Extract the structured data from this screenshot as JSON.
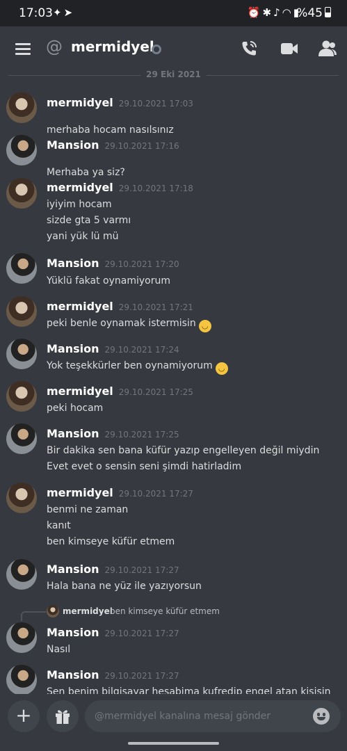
{
  "status_bar": {
    "time": "17:03",
    "battery": "%45"
  },
  "header": {
    "channel_name": "mermidyel"
  },
  "date_separator": "29 Eki 2021",
  "messages": [
    {
      "author": "mermidyel",
      "timestamp": "29.10.2021 17:03",
      "lines": [
        "merhaba hocam nasılsınız"
      ]
    },
    {
      "author": "Mansion",
      "timestamp": "29.10.2021 17:16",
      "lines": [
        "Merhaba ya siz?"
      ]
    },
    {
      "author": "mermidyel",
      "timestamp": "29.10.2021 17:18",
      "lines": [
        "iyiyim hocam",
        "sizde gta 5 varmı",
        "yani yük lü mü"
      ]
    },
    {
      "author": "Mansion",
      "timestamp": "29.10.2021 17:20",
      "lines": [
        "Yüklü fakat oynamiyorum"
      ]
    },
    {
      "author": "mermidyel",
      "timestamp": "29.10.2021 17:21",
      "lines": [
        "peki benle oynamak istermisin"
      ]
    },
    {
      "author": "Mansion",
      "timestamp": "29.10.2021 17:24",
      "lines": [
        "Yok teşekkürler ben oynamiyorum"
      ]
    },
    {
      "author": "mermidyel",
      "timestamp": "29.10.2021 17:25",
      "lines": [
        "peki hocam"
      ]
    },
    {
      "author": "Mansion",
      "timestamp": "29.10.2021 17:25",
      "lines": [
        "Bir dakika sen bana küfür yazıp engelleyen değil miydin",
        "Evet evet o sensin seni şimdi hatirladim"
      ]
    },
    {
      "author": "mermidyel",
      "timestamp": "29.10.2021 17:27",
      "lines": [
        "benmi ne zaman",
        "kanıt",
        "ben kimseye küfür etmem"
      ]
    },
    {
      "author": "Mansion",
      "timestamp": "29.10.2021 17:27",
      "lines": [
        "Hala bana ne yüz ile yazıyorsun"
      ]
    },
    {
      "author": "Mansion",
      "timestamp": "29.10.2021 17:27",
      "lines": [
        "Nasıl"
      ],
      "reply_to": {
        "author": "mermidyel",
        "text": "ben kimseye küfür etmem"
      }
    },
    {
      "author": "Mansion",
      "timestamp": "29.10.2021 17:27",
      "lines": [
        "Sen benim bilgisayar hesabima kufredip engel atan kisisin"
      ]
    }
  ],
  "composer": {
    "placeholder": "@mermidyel kanalına mesaj gönder"
  }
}
